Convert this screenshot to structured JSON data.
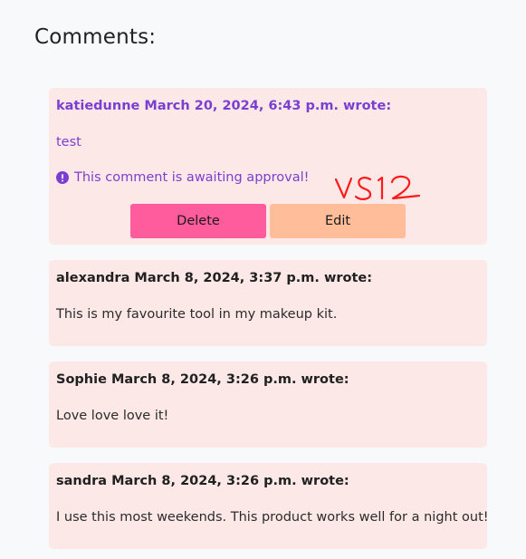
{
  "page": {
    "title": "Comments:"
  },
  "comments": [
    {
      "header": "katiedunne March 20, 2024, 6:43 p.m. wrote:",
      "body": "test",
      "notice": "This comment is awaiting approval!",
      "delete_label": "Delete",
      "edit_label": "Edit"
    },
    {
      "header": "alexandra March 8, 2024, 3:37 p.m. wrote:",
      "body": "This is my favourite tool in my makeup kit."
    },
    {
      "header": "Sophie March 8, 2024, 3:26 p.m. wrote:",
      "body": "Love love love it!"
    },
    {
      "header": "sandra March 8, 2024, 3:26 p.m. wrote:",
      "body": "I use this most weekends. This product works well for a night out!"
    }
  ],
  "annotation": {
    "text": "VS12",
    "color": "#ff1a1a"
  },
  "colors": {
    "card_bg": "#fde8e8",
    "pending_text": "#7b3fcf",
    "delete_button": "#ff5c9d",
    "edit_button": "#ffbd99"
  }
}
